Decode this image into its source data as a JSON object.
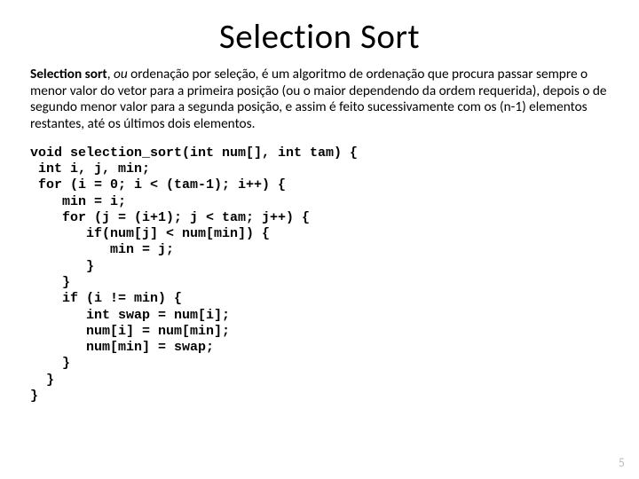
{
  "title": "Selection Sort",
  "desc_bold": "Selection sort",
  "desc_sep": ", ",
  "desc_ital": "ou",
  "desc_rest": " ordenação por seleção, é um algoritmo de ordenação que procura passar sempre o menor valor do vetor para a primeira posição (ou o maior dependendo da ordem requerida), depois o de segundo menor valor para a segunda posição, e assim é feito sucessivamente com os (n-1) elementos restantes, até os últimos dois elementos.",
  "code": "void selection_sort(int num[], int tam) {\n int i, j, min;\n for (i = 0; i < (tam-1); i++) {\n    min = i;\n    for (j = (i+1); j < tam; j++) {\n       if(num[j] < num[min]) {\n          min = j;\n       }\n    }\n    if (i != min) {\n       int swap = num[i];\n       num[i] = num[min];\n       num[min] = swap;\n    }\n  }\n}",
  "page_number": "5"
}
